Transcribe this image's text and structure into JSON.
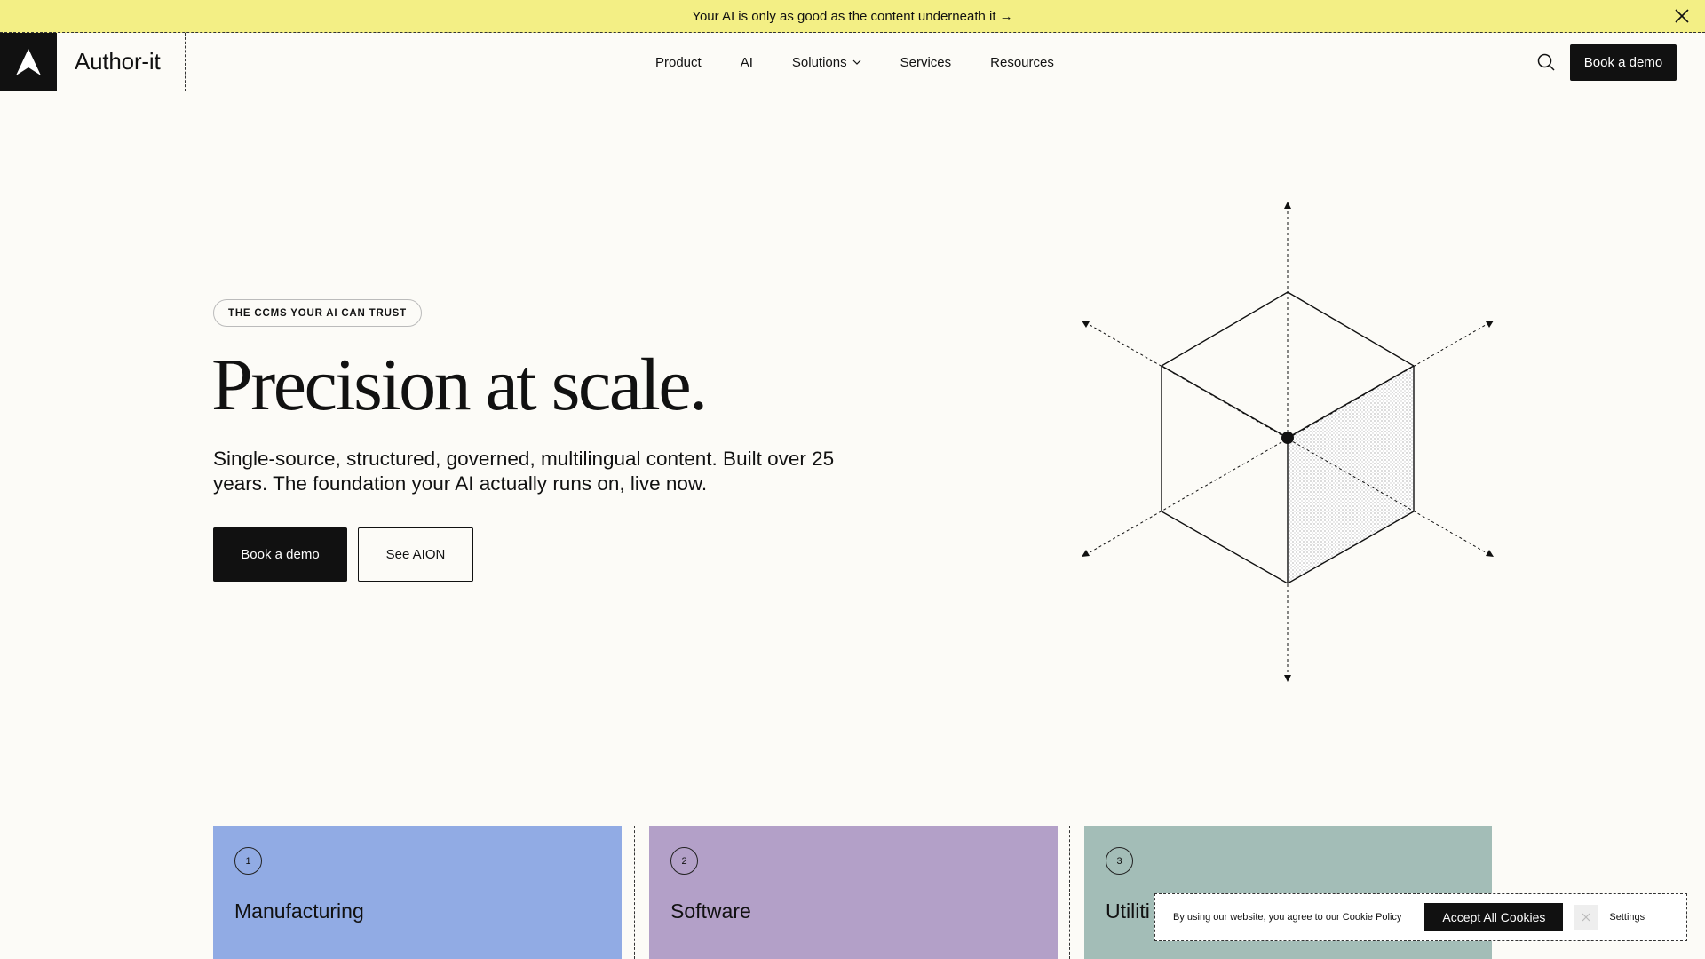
{
  "announcement": {
    "text": "Your AI is only as good as the content underneath it →",
    "close_icon": "close-icon"
  },
  "header": {
    "logo_text": "Author-it",
    "nav": [
      {
        "label": "Product"
      },
      {
        "label": "AI"
      },
      {
        "label": "Solutions",
        "has_dropdown": true
      },
      {
        "label": "Services"
      },
      {
        "label": "Resources"
      }
    ],
    "search_icon": "search-icon",
    "cta_label": "Book a demo"
  },
  "hero": {
    "eyebrow": "THE CCMS YOUR AI CAN TRUST",
    "title": "Precision at scale.",
    "subtitle": "Single-source, structured, governed, multilingual content. Built over 25 years. The foundation your AI actually runs on, live now.",
    "primary_cta": "Book a demo",
    "secondary_cta": "See AION",
    "illustration": "isometric-cube-icon"
  },
  "cards": [
    {
      "num": "1",
      "title": "Manufacturing",
      "color": "#91abe4"
    },
    {
      "num": "2",
      "title": "Software",
      "color": "#b3a0c8"
    },
    {
      "num": "3",
      "title": "Utiliti",
      "color": "#a3bdb7"
    }
  ],
  "cookie": {
    "text": "By using our website, you agree to our Cookie Policy",
    "accept_label": "Accept All Cookies",
    "settings_label": "Settings"
  },
  "colors": {
    "announcement_bg": "#f3ef85",
    "page_bg": "#fcfbf7",
    "dark": "#111111"
  }
}
